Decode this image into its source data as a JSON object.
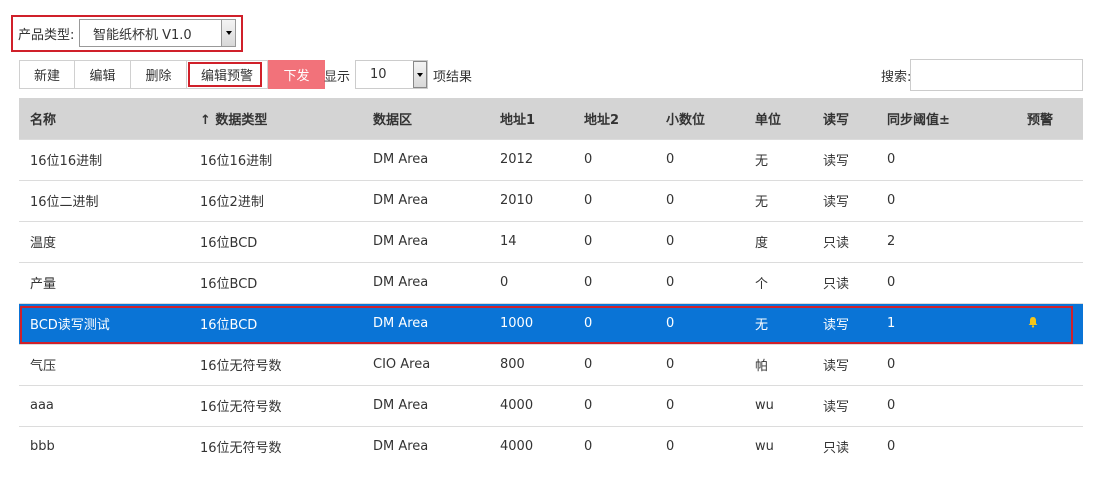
{
  "product": {
    "label": "产品类型:",
    "selected": "智能纸杯机 V1.0"
  },
  "toolbar": {
    "new_label": "新建",
    "edit_label": "编辑",
    "delete_label": "删除",
    "edit_alarm_label": "编辑预警",
    "issue_label": "下发",
    "issue_color": "#f2727a"
  },
  "length": {
    "prefix": "显示",
    "selected": "10",
    "suffix": "项结果"
  },
  "search": {
    "label": "搜索:",
    "value": ""
  },
  "table": {
    "headers": [
      "名称",
      "↑ 数据类型",
      "数据区",
      "地址1",
      "地址2",
      "小数位",
      "单位",
      "读写",
      "同步阈值±",
      "预警"
    ],
    "rows": [
      [
        "16位16进制",
        "16位16进制",
        "DM Area",
        "2012",
        "0",
        "0",
        "无",
        "读写",
        "0",
        ""
      ],
      [
        "16位二进制",
        "16位2进制",
        "DM Area",
        "2010",
        "0",
        "0",
        "无",
        "读写",
        "0",
        ""
      ],
      [
        "温度",
        "16位BCD",
        "DM Area",
        "14",
        "0",
        "0",
        "度",
        "只读",
        "2",
        ""
      ],
      [
        "产量",
        "16位BCD",
        "DM Area",
        "0",
        "0",
        "0",
        "个",
        "只读",
        "0",
        ""
      ],
      [
        "BCD读写测试",
        "16位BCD",
        "DM Area",
        "1000",
        "0",
        "0",
        "无",
        "读写",
        "1",
        "bell-icon"
      ],
      [
        "气压",
        "16位无符号数",
        "CIO Area",
        "800",
        "0",
        "0",
        "帕",
        "读写",
        "0",
        ""
      ],
      [
        "aaa",
        "16位无符号数",
        "DM Area",
        "4000",
        "0",
        "0",
        "wu",
        "读写",
        "0",
        ""
      ],
      [
        "bbb",
        "16位无符号数",
        "DM Area",
        "4000",
        "0",
        "0",
        "wu",
        "只读",
        "0",
        ""
      ]
    ],
    "selected_row": 4,
    "header_bg": "#d4d4d4",
    "selected_bg": "#0a74d6",
    "alarm_icon_color": "#f5c518"
  },
  "highlight_color": "#d0202a"
}
